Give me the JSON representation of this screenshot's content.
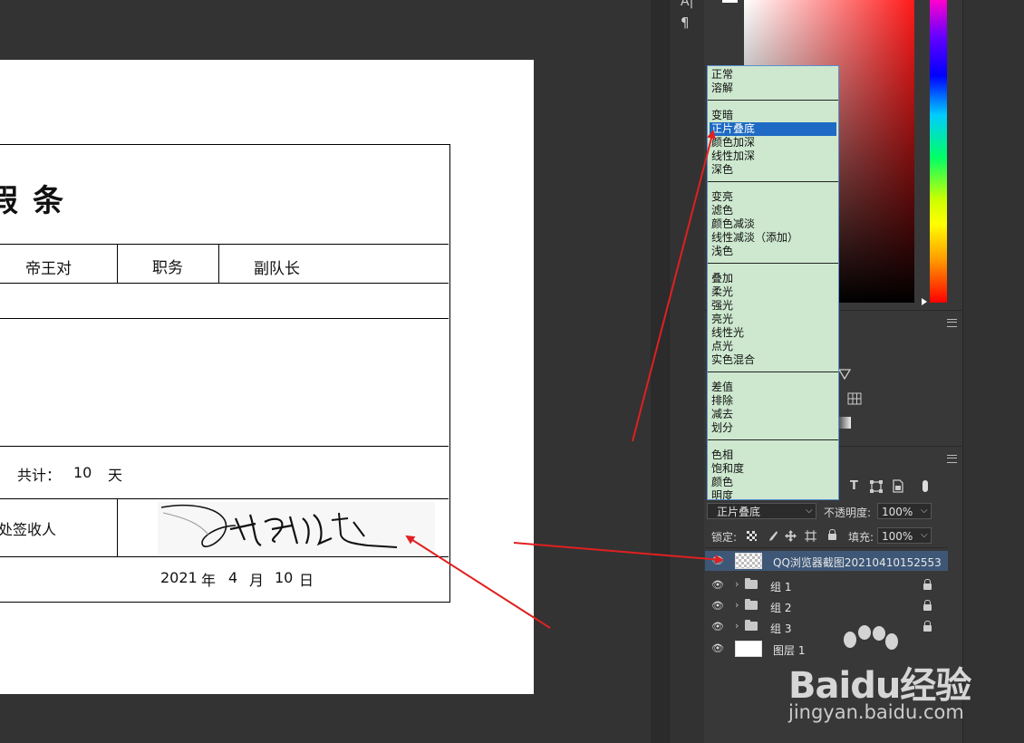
{
  "document": {
    "title": "假条",
    "cells": {
      "name_value": "帝王对",
      "position_label": "职务",
      "position_value": "副队长",
      "total_label": "共计：",
      "total_value": "10",
      "total_unit": "天",
      "signer_label": "处签收人",
      "date_year": "2021",
      "date_year_unit": "年",
      "date_month": "4",
      "date_month_unit": "月",
      "date_day": "10",
      "date_day_unit": "日"
    }
  },
  "toolstrip": {
    "icons": [
      "character-panel-icon",
      "paragraph-icon"
    ],
    "paragraph_glyph": "¶",
    "char_glyph": "A|"
  },
  "blend_menu": {
    "groups": [
      [
        "正常",
        "溶解"
      ],
      [
        "变暗",
        "正片叠底",
        "颜色加深",
        "线性加深",
        "深色"
      ],
      [
        "变亮",
        "滤色",
        "颜色减淡",
        "线性减淡（添加）",
        "浅色"
      ],
      [
        "叠加",
        "柔光",
        "强光",
        "亮光",
        "线性光",
        "点光",
        "实色混合"
      ],
      [
        "差值",
        "排除",
        "减去",
        "划分"
      ],
      [
        "色相",
        "饱和度",
        "颜色",
        "明度"
      ]
    ],
    "selected": "正片叠底"
  },
  "layers_panel": {
    "blend_mode_value": "正片叠底",
    "opacity_label": "不透明度:",
    "opacity_value": "100%",
    "lock_label": "锁定:",
    "fill_label": "填充:",
    "fill_value": "100%",
    "layers": [
      {
        "name": "QQ浏览器截图20210410152553",
        "type": "image",
        "selected": true
      },
      {
        "name": "组 1",
        "type": "group",
        "locked": true
      },
      {
        "name": "组 2",
        "type": "group",
        "locked": true
      },
      {
        "name": "组 3",
        "type": "group",
        "locked": true
      },
      {
        "name": "图层 1",
        "type": "image",
        "selected": false
      }
    ]
  },
  "watermark": {
    "brand": "Baidu经验",
    "url": "jingyan.baidu.com"
  },
  "colors": {
    "arrow": "#e02020",
    "menu_bg": "#cde8cf",
    "menu_selected": "#1e6ac4",
    "layer_selected": "#3e5777"
  }
}
